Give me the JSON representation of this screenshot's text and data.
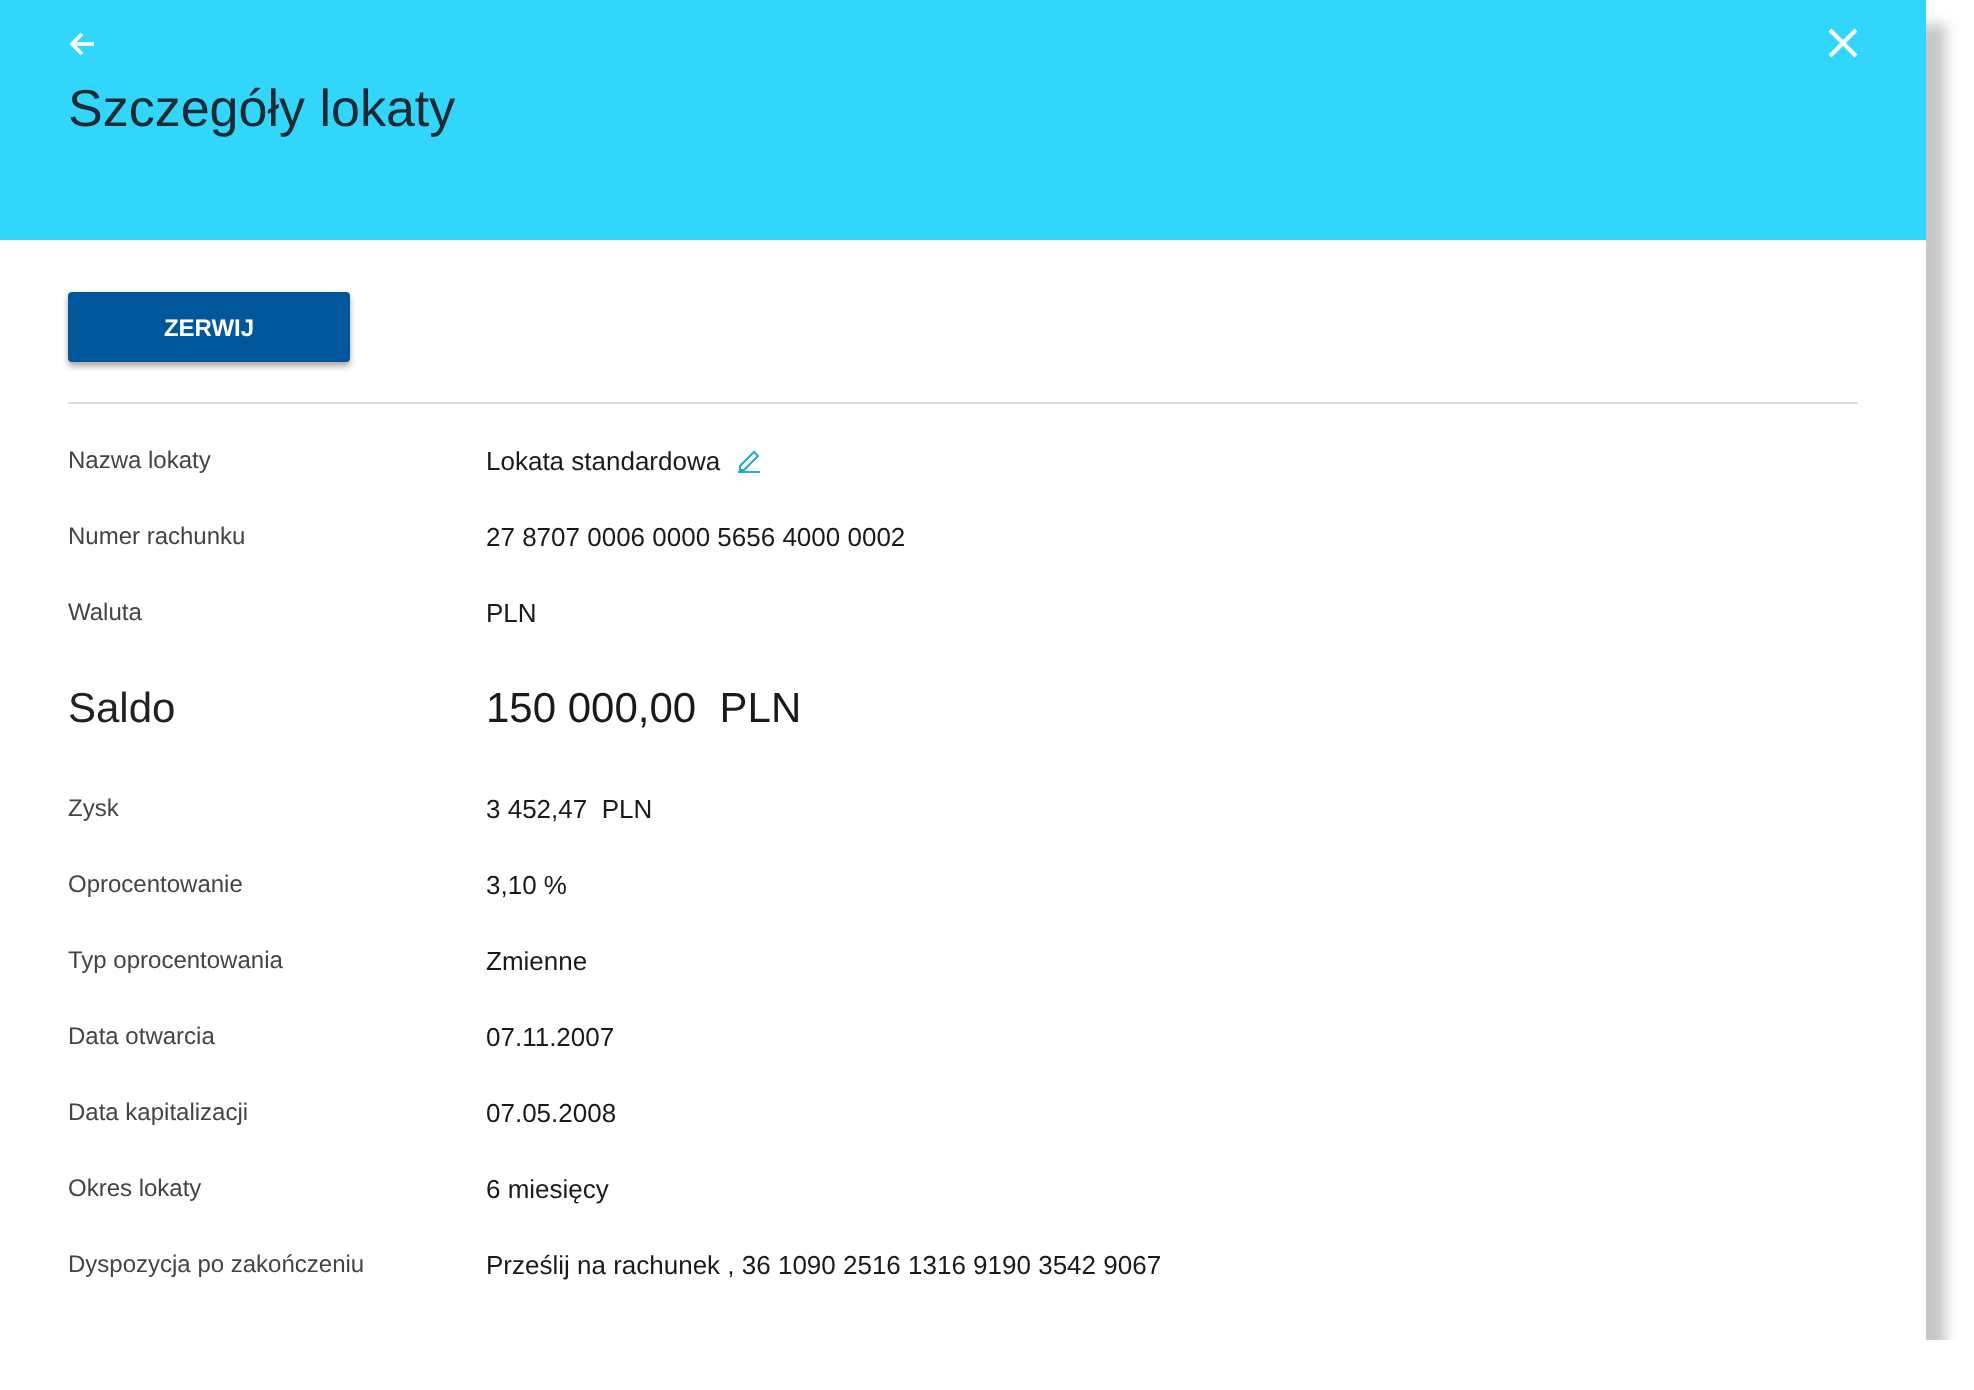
{
  "header": {
    "title": "Szczegóły lokaty"
  },
  "action_button": "ZERWIJ",
  "details": [
    {
      "kind": "normal",
      "label": "Nazwa lokaty",
      "value": "Lokata standardowa",
      "editable": true
    },
    {
      "kind": "normal",
      "label": "Numer rachunku",
      "value": "27 8707 0006 0000 5656 4000 0002",
      "editable": false
    },
    {
      "kind": "normal",
      "label": "Waluta",
      "value": "PLN",
      "editable": false
    },
    {
      "kind": "large",
      "label": "Saldo",
      "value": "150 000,00  PLN",
      "editable": false
    },
    {
      "kind": "normal",
      "label": "Zysk",
      "value": "3 452,47  PLN",
      "editable": false
    },
    {
      "kind": "normal",
      "label": "Oprocentowanie",
      "value": "3,10 %",
      "editable": false
    },
    {
      "kind": "normal",
      "label": "Typ oprocentowania",
      "value": "Zmienne",
      "editable": false
    },
    {
      "kind": "normal",
      "label": "Data otwarcia",
      "value": "07.11.2007",
      "editable": false
    },
    {
      "kind": "normal",
      "label": "Data kapitalizacji",
      "value": "07.05.2008",
      "editable": false
    },
    {
      "kind": "normal",
      "label": "Okres lokaty",
      "value": "6 miesięcy",
      "editable": false
    },
    {
      "kind": "normal",
      "label": "Dyspozycja po zakończeniu",
      "value": "Prześlij na rachunek , 36 1090 2516 1316 9190 3542 9067",
      "editable": false
    }
  ]
}
